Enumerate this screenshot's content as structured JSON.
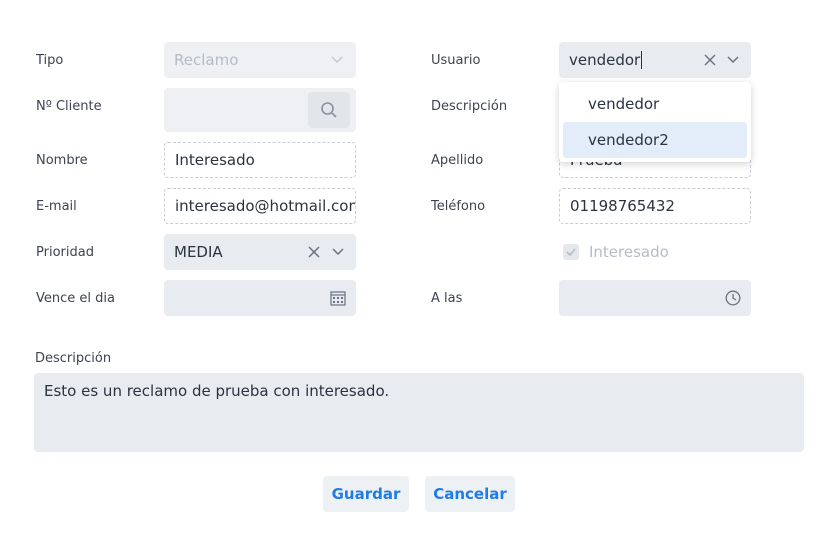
{
  "form": {
    "tipo": {
      "label": "Tipo",
      "value": "Reclamo"
    },
    "cliente": {
      "label": "Nº Cliente",
      "value": ""
    },
    "nombre": {
      "label": "Nombre",
      "value": "Interesado"
    },
    "email": {
      "label": "E-mail",
      "value": "interesado@hotmail.com"
    },
    "prioridad": {
      "label": "Prioridad",
      "value": "MEDIA"
    },
    "vence": {
      "label": "Vence el dia",
      "value": ""
    },
    "usuario": {
      "label": "Usuario",
      "value": "vendedor",
      "options": [
        "vendedor",
        "vendedor2"
      ],
      "highlighted": "vendedor2"
    },
    "descripcion_corta": {
      "label": "Descripción"
    },
    "apellido": {
      "label": "Apellido",
      "value": "Prueba"
    },
    "telefono": {
      "label": "Teléfono",
      "value": "01198765432"
    },
    "interesado_checkbox": {
      "label": "Interesado",
      "checked": true
    },
    "hora": {
      "label": "A las",
      "value": ""
    },
    "descripcion": {
      "label": "Descripción",
      "value": "Esto es un reclamo de prueba con interesado."
    }
  },
  "buttons": {
    "save": "Guardar",
    "cancel": "Cancelar"
  },
  "icons": {
    "clear": "×",
    "chevron": "chevron-down",
    "search": "search",
    "calendar": "calendar",
    "clock": "clock",
    "check": "check"
  },
  "colors": {
    "accent": "#1e7be8",
    "field_bg": "#e8ebef",
    "highlight": "#e2edf9"
  }
}
